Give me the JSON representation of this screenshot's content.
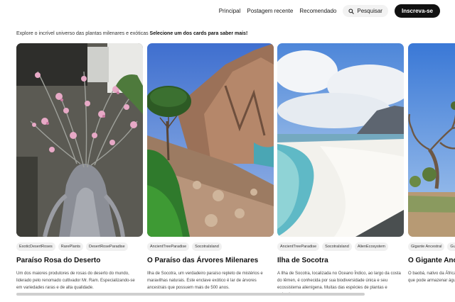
{
  "nav": {
    "links": [
      "Principal",
      "Postagem recente",
      "Recomendado"
    ],
    "search_label": "Pesquisar",
    "search_icon": "search-icon",
    "subscribe_label": "Inscreva-se"
  },
  "intro": {
    "text": "Explore o incrível universo das plantas milenares e exóticas",
    "bold": "Selecione um dos cards para saber mais!"
  },
  "cards": [
    {
      "tags": [
        "ExoticDesertRoses",
        "RarePlants",
        "DesertRoseParadise"
      ],
      "title": "Paraíso Rosa do Deserto",
      "text": "Um dos maiores produtores de rosas do deserto do mundo, liderado pelo renomado cultivador Mr. Ram. Especializando-se em variedades raras e de alta qualidade."
    },
    {
      "tags": [
        "AncientTreeParadise",
        "SocotraIsland"
      ],
      "title": "O Paraíso das Árvores Milenares",
      "text": "Ilha de Socotra, um verdadeiro paraíso repleto de mistérios e maravilhas naturais. Este enclave exótico é lar de árvores ancestrais que possuem mais de 500 anos."
    },
    {
      "tags": [
        "AncientTreeParadise",
        "SocotraIsland",
        "AlienEcosystem"
      ],
      "title": "Ilha de Socotra",
      "text": "A Ilha de Socotra, localizada no Oceano Índico, ao largo da costa do Iêmen, é conhecida por sua biodiversidade única e seu ecossistema alienígena. Muitas das espécies de plantas e animais."
    },
    {
      "tags": [
        "Gigante Ancestral",
        "Guard"
      ],
      "title": "O Gigante Ancestral",
      "text": "O baobá, nativo da África, é conhecido por seu tronco robusto que pode armazenar água e viver mais de 2.000 anos."
    }
  ]
}
